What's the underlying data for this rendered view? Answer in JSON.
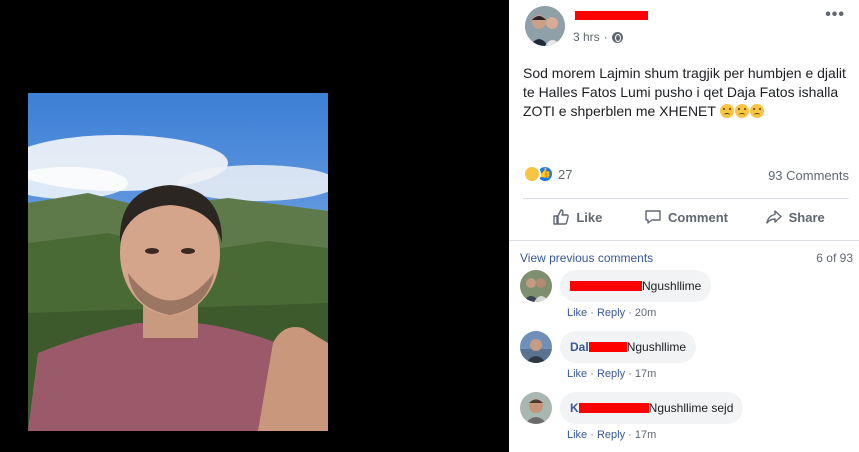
{
  "post": {
    "time": "3 hrs",
    "separator": "·",
    "more": "•••",
    "text": "Sod morem Lajmin shum tragjik per humbjen e djalit te Halles Fatos Lumi pusho i qet Daja Fatos ishalla ZOTI e shperblen me XHENET",
    "reaction_count": "27",
    "comments_count": "93 Comments"
  },
  "actions": {
    "like": "Like",
    "comment": "Comment",
    "share": "Share"
  },
  "comments_section": {
    "view_previous": "View previous comments",
    "pager": "6 of 93"
  },
  "comments": [
    {
      "text": "Ngushllime",
      "like": "Like",
      "reply": "Reply",
      "time": "20m"
    },
    {
      "name_visible": "Dal",
      "text": "Ngushllime",
      "like": "Like",
      "reply": "Reply",
      "time": "17m"
    },
    {
      "name_visible": "K",
      "text": "Ngushllime sejd",
      "like": "Like",
      "reply": "Reply",
      "time": "17m"
    }
  ],
  "colors": {
    "link": "#385898",
    "meta": "#606770",
    "redaction": "#ff0000",
    "like_blue": "#1877f2"
  }
}
